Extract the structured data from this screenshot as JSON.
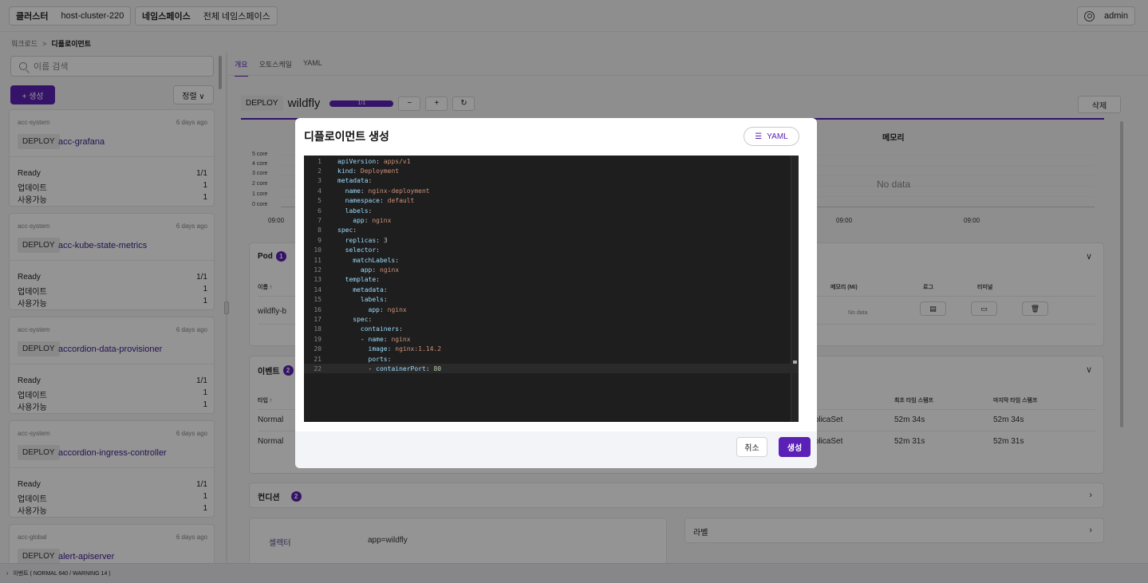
{
  "topbar": {
    "cluster_label": "클러스터",
    "cluster_value": "host-cluster-220",
    "namespace_label": "네임스페이스",
    "namespace_value": "전체 네임스페이스",
    "user": "admin"
  },
  "breadcrumb": {
    "parent": "워크로드",
    "sep": ">",
    "current": "디플로이먼트"
  },
  "sidebar": {
    "search_placeholder": "이름 검색",
    "create_label": "+ 생성",
    "sort_label": "정렬 ∨",
    "cards": [
      {
        "ns": "acc-system",
        "ago": "6 days ago",
        "kind": "DEPLOY",
        "name": "acc-grafana",
        "ready": "1/1",
        "update": "1",
        "avail": "1"
      },
      {
        "ns": "acc-system",
        "ago": "6 days ago",
        "kind": "DEPLOY",
        "name": "acc-kube-state-metrics",
        "ready": "1/1",
        "update": "1",
        "avail": "1"
      },
      {
        "ns": "acc-system",
        "ago": "6 days ago",
        "kind": "DEPLOY",
        "name": "accordion-data-provisioner",
        "ready": "1/1",
        "update": "1",
        "avail": "1"
      },
      {
        "ns": "acc-system",
        "ago": "6 days ago",
        "kind": "DEPLOY",
        "name": "accordion-ingress-controller",
        "ready": "1/1",
        "update": "1",
        "avail": "1"
      },
      {
        "ns": "acc-global",
        "ago": "6 days ago",
        "kind": "DEPLOY",
        "name": "alert-apiserver"
      }
    ],
    "row_labels": {
      "ready": "Ready",
      "update": "업데이트",
      "avail": "사용가능"
    }
  },
  "main": {
    "tabs": [
      "개요",
      "오토스케일",
      "YAML"
    ],
    "resource": {
      "kind": "DEPLOY",
      "name": "wildfly",
      "replicas": "1/1",
      "minus": "−",
      "plus": "+",
      "refresh": "↻",
      "delete": "삭제"
    },
    "cpu_ticks": [
      "5 core",
      "4 core",
      "3 core",
      "2 core",
      "1 core",
      "0 core"
    ],
    "cpu_xtick": "09:00",
    "memory_title": "메모리",
    "memory_nodata": "No data",
    "memory_xticks": [
      "09:00",
      "09:00"
    ],
    "pod": {
      "title": "Pod",
      "count": "1",
      "headers": {
        "name": "이름 ↑",
        "memory": "메모리 (Mi)",
        "log": "로그",
        "terminal": "터미널"
      },
      "row": {
        "name": "wildfly-b",
        "memory": "No data"
      }
    },
    "events": {
      "title": "이벤트",
      "count": "2",
      "headers": {
        "type": "타입 ↑",
        "first": "최초 타임 스탬프",
        "last": "마지막 타임 스탬프"
      },
      "rows": [
        {
          "type": "Normal",
          "obj": "ReplicaSet",
          "first": "52m 34s",
          "last": "52m 34s"
        },
        {
          "type": "Normal",
          "obj": "ReplicaSet",
          "first": "52m 31s",
          "last": "52m 31s"
        }
      ]
    },
    "conditions": {
      "title": "컨디션",
      "count": "2"
    },
    "selector": {
      "label": "셀렉터",
      "value": "app=wildfly"
    },
    "labels_title": "라벨"
  },
  "bottombar": {
    "text": "이벤트 ( NORMAL 640 / WARNING 14 )"
  },
  "modal": {
    "title": "디플로이먼트 생성",
    "yaml_btn": "YAML",
    "cancel": "취소",
    "create": "생성",
    "lines": [
      [
        [
          "key",
          "apiVersion"
        ],
        [
          "plain",
          ": "
        ],
        [
          "str",
          "apps/v1"
        ]
      ],
      [
        [
          "key",
          "kind"
        ],
        [
          "plain",
          ": "
        ],
        [
          "str",
          "Deployment"
        ]
      ],
      [
        [
          "key",
          "metadata"
        ],
        [
          "plain",
          ":"
        ]
      ],
      [
        [
          "plain",
          "  "
        ],
        [
          "key",
          "name"
        ],
        [
          "plain",
          ": "
        ],
        [
          "str",
          "nginx-deployment"
        ]
      ],
      [
        [
          "plain",
          "  "
        ],
        [
          "key",
          "namespace"
        ],
        [
          "plain",
          ": "
        ],
        [
          "str",
          "default"
        ]
      ],
      [
        [
          "plain",
          "  "
        ],
        [
          "key",
          "labels"
        ],
        [
          "plain",
          ":"
        ]
      ],
      [
        [
          "plain",
          "    "
        ],
        [
          "key",
          "app"
        ],
        [
          "plain",
          ": "
        ],
        [
          "str",
          "nginx"
        ]
      ],
      [
        [
          "key",
          "spec"
        ],
        [
          "plain",
          ":"
        ]
      ],
      [
        [
          "plain",
          "  "
        ],
        [
          "key",
          "replicas"
        ],
        [
          "plain",
          ": "
        ],
        [
          "num",
          "3"
        ]
      ],
      [
        [
          "plain",
          "  "
        ],
        [
          "key",
          "selector"
        ],
        [
          "plain",
          ":"
        ]
      ],
      [
        [
          "plain",
          "    "
        ],
        [
          "key",
          "matchLabels"
        ],
        [
          "plain",
          ":"
        ]
      ],
      [
        [
          "plain",
          "      "
        ],
        [
          "key",
          "app"
        ],
        [
          "plain",
          ": "
        ],
        [
          "str",
          "nginx"
        ]
      ],
      [
        [
          "plain",
          "  "
        ],
        [
          "key",
          "template"
        ],
        [
          "plain",
          ":"
        ]
      ],
      [
        [
          "plain",
          "    "
        ],
        [
          "key",
          "metadata"
        ],
        [
          "plain",
          ":"
        ]
      ],
      [
        [
          "plain",
          "      "
        ],
        [
          "key",
          "labels"
        ],
        [
          "plain",
          ":"
        ]
      ],
      [
        [
          "plain",
          "        "
        ],
        [
          "key",
          "app"
        ],
        [
          "plain",
          ": "
        ],
        [
          "str",
          "nginx"
        ]
      ],
      [
        [
          "plain",
          "    "
        ],
        [
          "key",
          "spec"
        ],
        [
          "plain",
          ":"
        ]
      ],
      [
        [
          "plain",
          "      "
        ],
        [
          "key",
          "containers"
        ],
        [
          "plain",
          ":"
        ]
      ],
      [
        [
          "plain",
          "      - "
        ],
        [
          "key",
          "name"
        ],
        [
          "plain",
          ": "
        ],
        [
          "str",
          "nginx"
        ]
      ],
      [
        [
          "plain",
          "        "
        ],
        [
          "key",
          "image"
        ],
        [
          "plain",
          ": "
        ],
        [
          "str",
          "nginx:1.14.2"
        ]
      ],
      [
        [
          "plain",
          "        "
        ],
        [
          "key",
          "ports"
        ],
        [
          "plain",
          ":"
        ]
      ],
      [
        [
          "plain",
          "        - "
        ],
        [
          "key",
          "containerPort"
        ],
        [
          "plain",
          ": "
        ],
        [
          "num",
          "80"
        ]
      ]
    ]
  }
}
